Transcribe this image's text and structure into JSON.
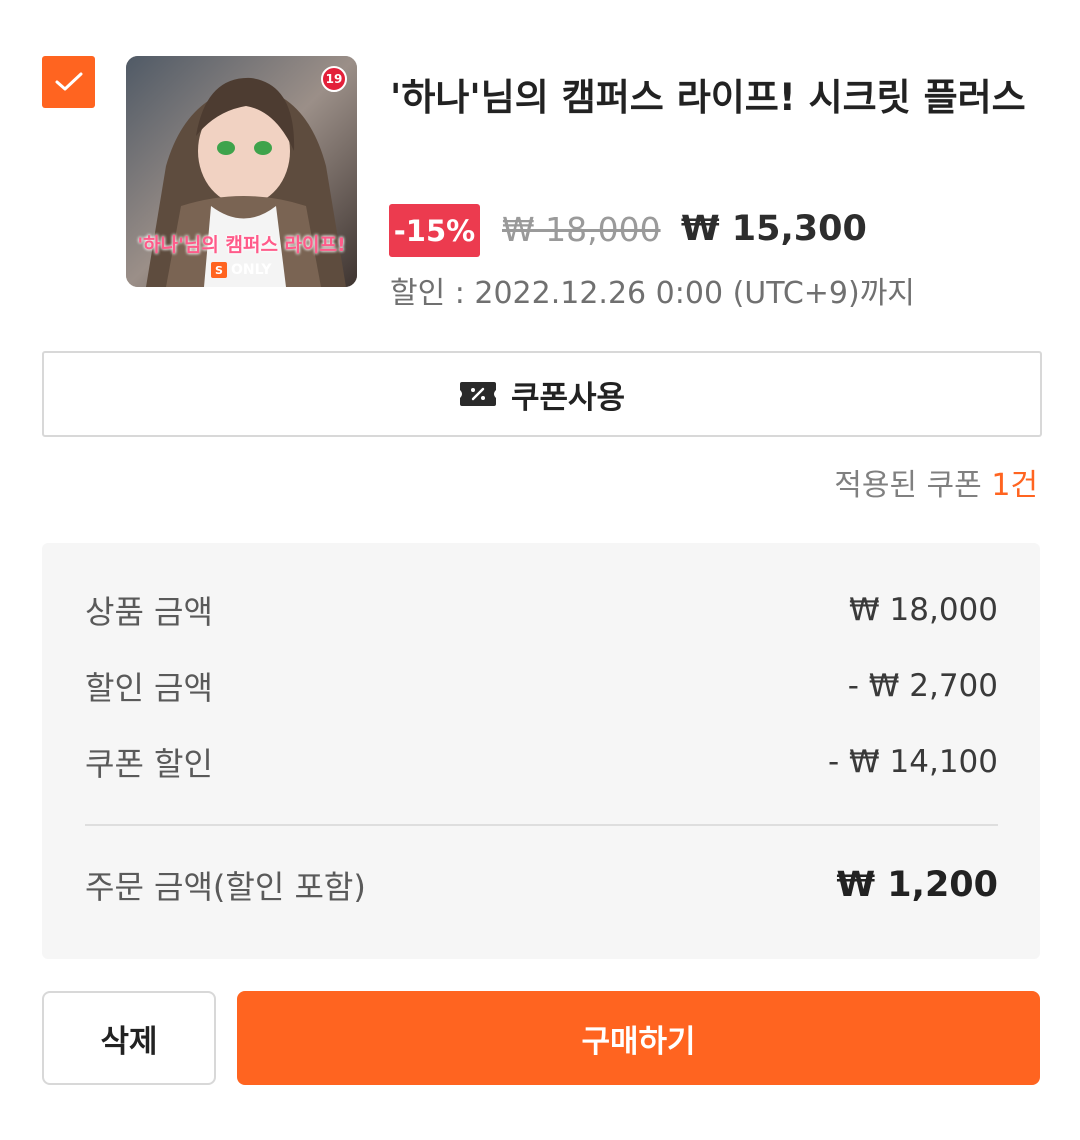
{
  "item": {
    "checked": true,
    "age_rating": "19",
    "cover_title": "'하나'님의 캠퍼스 라이프!",
    "cover_badge": "ONLY",
    "cover_badge_letter": "S",
    "title": "'하나'님의 캠퍼스 라이프! 시크릿 플러스",
    "discount_badge": "-15%",
    "original_price": "₩ 18,000",
    "sale_price": "₩ 15,300",
    "discount_until": "할인 : 2022.12.26 0:00 (UTC+9)까지"
  },
  "coupon": {
    "button_label": "쿠폰사용",
    "applied_label": "적용된 쿠폰",
    "applied_count": "1건"
  },
  "summary": {
    "product_amount_label": "상품 금액",
    "product_amount": "₩ 18,000",
    "discount_amount_label": "할인 금액",
    "discount_amount": "- ₩ 2,700",
    "coupon_discount_label": "쿠폰 할인",
    "coupon_discount": "- ₩ 14,100",
    "order_amount_label": "주문 금액(할인 포함)",
    "order_amount": "₩ 1,200"
  },
  "actions": {
    "delete_label": "삭제",
    "buy_label": "구매하기"
  },
  "colors": {
    "accent": "#ff6420",
    "discount_badge": "#ec3b4f"
  }
}
